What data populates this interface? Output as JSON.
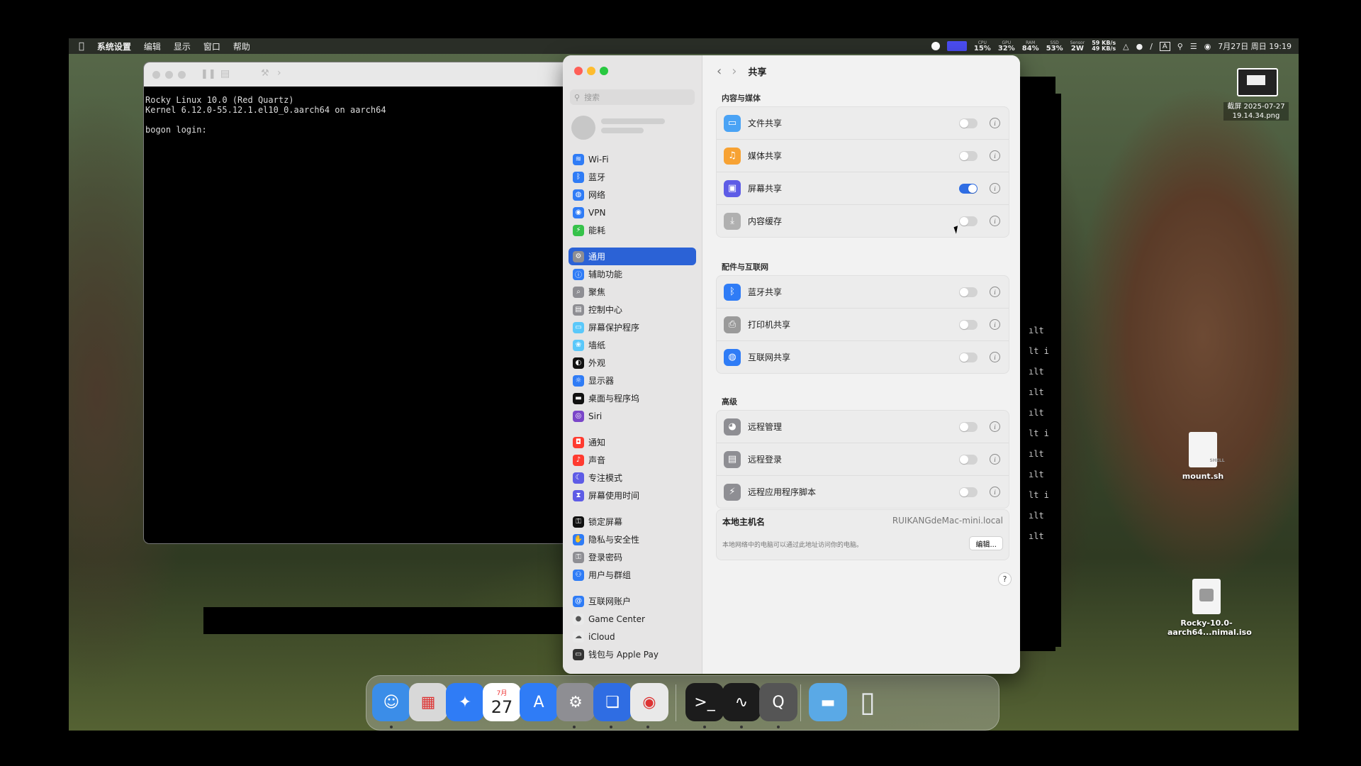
{
  "menubar": {
    "apple": "",
    "items": [
      "系统设置",
      "编辑",
      "显示",
      "窗口",
      "帮助"
    ],
    "status": {
      "cpu_label": "CPU",
      "cpu": "15%",
      "gpu_label": "GPU",
      "gpu": "32%",
      "ram_label": "RAM",
      "ram": "84%",
      "ssd_label": "SSD",
      "ssd": "53%",
      "sensor_label": "Sensor",
      "sensor": "2W",
      "net_up": "59 KB/s",
      "net_down": "49 KB/s",
      "input": "A",
      "datetime": "7月27日 周日 19:19"
    }
  },
  "terminal": {
    "lines": "Rocky Linux 10.0 (Red Quartz)\nKernel 6.12.0-55.12.1.el10_0.aarch64 on aarch64\n\nbogon login:"
  },
  "bg_terminal": {
    "fragments": [
      "ılt",
      "lt i",
      "ılt",
      "ılt",
      "ılt",
      "lt i",
      "ılt",
      "ılt",
      "lt i",
      "ılt",
      "ılt"
    ]
  },
  "settings": {
    "search_placeholder": "搜索",
    "title": "共享",
    "sidebar": [
      {
        "label": "Wi-Fi",
        "color": "#2f7cf6",
        "glyph": "≋",
        "gap": false
      },
      {
        "label": "蓝牙",
        "color": "#2f7cf6",
        "glyph": "ᛒ",
        "gap": false
      },
      {
        "label": "网络",
        "color": "#2f7cf6",
        "glyph": "◍",
        "gap": false
      },
      {
        "label": "VPN",
        "color": "#2f7cf6",
        "glyph": "◉",
        "gap": false
      },
      {
        "label": "能耗",
        "color": "#36c24a",
        "glyph": "⚡",
        "gap": false
      },
      {
        "label": "通用",
        "color": "#8e8e93",
        "glyph": "⚙",
        "gap": true,
        "active": true
      },
      {
        "label": "辅助功能",
        "color": "#2f7cf6",
        "glyph": "ⓘ",
        "gap": false
      },
      {
        "label": "聚焦",
        "color": "#8e8e93",
        "glyph": "⌕",
        "gap": false
      },
      {
        "label": "控制中心",
        "color": "#8e8e93",
        "glyph": "▤",
        "gap": false
      },
      {
        "label": "屏幕保护程序",
        "color": "#5ac8fa",
        "glyph": "▭",
        "gap": false
      },
      {
        "label": "墙纸",
        "color": "#5ac8fa",
        "glyph": "❀",
        "gap": false
      },
      {
        "label": "外观",
        "color": "#111111",
        "glyph": "◐",
        "gap": false
      },
      {
        "label": "显示器",
        "color": "#2f7cf6",
        "glyph": "☼",
        "gap": false
      },
      {
        "label": "桌面与程序坞",
        "color": "#111111",
        "glyph": "▬",
        "gap": false
      },
      {
        "label": "Siri",
        "color": "#7a46c9",
        "glyph": "◎",
        "gap": false
      },
      {
        "label": "通知",
        "color": "#ff3b30",
        "glyph": "◘",
        "gap": true
      },
      {
        "label": "声音",
        "color": "#ff3b30",
        "glyph": "♪",
        "gap": false
      },
      {
        "label": "专注模式",
        "color": "#5e5ce6",
        "glyph": "☾",
        "gap": false
      },
      {
        "label": "屏幕使用时间",
        "color": "#5e5ce6",
        "glyph": "⧗",
        "gap": false
      },
      {
        "label": "锁定屏幕",
        "color": "#111111",
        "glyph": "⚿",
        "gap": true
      },
      {
        "label": "隐私与安全性",
        "color": "#2f7cf6",
        "glyph": "✋",
        "gap": false
      },
      {
        "label": "登录密码",
        "color": "#8e8e93",
        "glyph": "⚿",
        "gap": false
      },
      {
        "label": "用户与群组",
        "color": "#2f7cf6",
        "glyph": "⚇",
        "gap": false
      },
      {
        "label": "互联网账户",
        "color": "#2f7cf6",
        "glyph": "@",
        "gap": true
      },
      {
        "label": "Game Center",
        "color": "#e9e9e9",
        "glyph": "●",
        "gap": false
      },
      {
        "label": "iCloud",
        "color": "#e9e9e9",
        "glyph": "☁",
        "gap": false
      },
      {
        "label": "钱包与 Apple Pay",
        "color": "#333333",
        "glyph": "▭",
        "gap": false
      }
    ],
    "sections": [
      {
        "title": "内容与媒体",
        "rows": [
          {
            "label": "文件共享",
            "color": "#4aa3f5",
            "glyph": "▭",
            "on": false
          },
          {
            "label": "媒体共享",
            "color": "#f7a233",
            "glyph": "♫",
            "on": false
          },
          {
            "label": "屏幕共享",
            "color": "#5e5ce6",
            "glyph": "▣",
            "on": true
          },
          {
            "label": "内容缓存",
            "color": "#b0b0b0",
            "glyph": "⤓",
            "on": false
          }
        ]
      },
      {
        "title": "配件与互联网",
        "rows": [
          {
            "label": "蓝牙共享",
            "color": "#2f7cf6",
            "glyph": "ᛒ",
            "on": false
          },
          {
            "label": "打印机共享",
            "color": "#9a9a9a",
            "glyph": "⎙",
            "on": false
          },
          {
            "label": "互联网共享",
            "color": "#2f7cf6",
            "glyph": "◍",
            "on": false
          }
        ]
      },
      {
        "title": "高级",
        "rows": [
          {
            "label": "远程管理",
            "color": "#8e8e93",
            "glyph": "◕",
            "on": false
          },
          {
            "label": "远程登录",
            "color": "#8e8e93",
            "glyph": "▤",
            "on": false
          },
          {
            "label": "远程应用程序脚本",
            "color": "#8e8e93",
            "glyph": "⚡",
            "on": false
          }
        ]
      }
    ],
    "hostname_label": "本地主机名",
    "hostname_value": "RUIKANGdeMac-mini.local",
    "hostname_desc": "本地网络中的电脑可以通过此地址访问你的电脑。",
    "edit_button": "编辑...",
    "help": "?"
  },
  "desktop": {
    "screenshot_label": "截屏 2025-07-27 19.14.34.png",
    "file1_label": "mount.sh",
    "file1_type": "SHELL",
    "file2_label": "Rocky-10.0-aarch64...nimal.iso"
  },
  "dock": {
    "apps": [
      {
        "name": "finder",
        "color": "#3b8de8",
        "glyph": "☺"
      },
      {
        "name": "launchpad",
        "color": "#d8d8d8",
        "glyph": "▦"
      },
      {
        "name": "safari",
        "color": "#2f7cf6",
        "glyph": "✦"
      },
      {
        "name": "calendar",
        "color": "#ffffff",
        "glyph": "27",
        "month": "7月"
      },
      {
        "name": "app-store",
        "color": "#2f7cf6",
        "glyph": "A"
      },
      {
        "name": "system-settings",
        "color": "#8e8e93",
        "glyph": "⚙"
      },
      {
        "name": "vmware",
        "color": "#2f6de3",
        "glyph": "❏"
      },
      {
        "name": "chrome",
        "color": "#e9e9e9",
        "glyph": "◉"
      },
      {
        "name": "terminal",
        "color": "#1c1c1c",
        "glyph": ">_"
      },
      {
        "name": "activity-monitor",
        "color": "#1c1c1c",
        "glyph": "∿"
      },
      {
        "name": "quicktime",
        "color": "#555555",
        "glyph": "Q"
      },
      {
        "name": "folder",
        "color": "#5aa9e6",
        "glyph": "▬"
      },
      {
        "name": "trash",
        "color": "#cfd3d6",
        "glyph": "▯"
      }
    ]
  }
}
